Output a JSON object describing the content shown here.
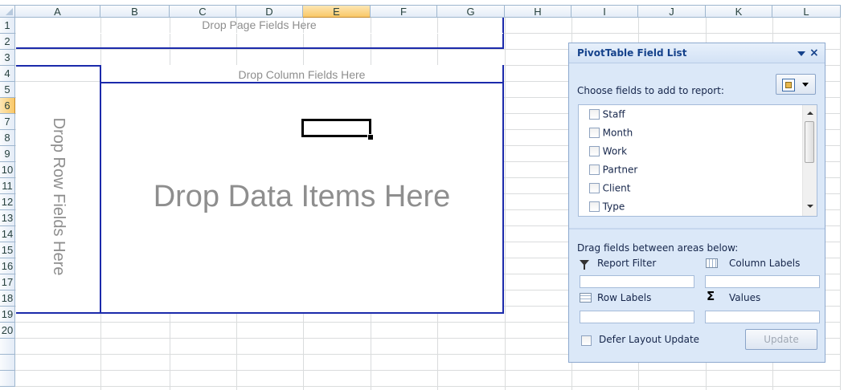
{
  "columns": [
    "A",
    "B",
    "C",
    "D",
    "E",
    "F",
    "G",
    "H",
    "I",
    "J",
    "K",
    "L"
  ],
  "rows": [
    "1",
    "2",
    "3",
    "4",
    "5",
    "6",
    "7",
    "8",
    "9",
    "10",
    "11",
    "12",
    "13",
    "14",
    "15",
    "16",
    "17",
    "18",
    "19",
    "20"
  ],
  "selected_column": "E",
  "selected_row": "6",
  "pivot": {
    "page_fields": "Drop Page Fields Here",
    "column_fields": "Drop Column Fields Here",
    "row_fields": "Drop Row Fields Here",
    "data_items": "Drop Data Items Here"
  },
  "pane": {
    "title": "PivotTable Field List",
    "choose_label": "Choose fields to add to report:",
    "fields": [
      "Staff",
      "Month",
      "Work",
      "Partner",
      "Client",
      "Type"
    ],
    "drag_label": "Drag fields between areas below:",
    "report_filter": "Report Filter",
    "column_labels": "Column Labels",
    "row_labels": "Row Labels",
    "values": "Values",
    "defer_label": "Defer Layout Update",
    "update_button": "Update"
  },
  "icons": {
    "menu": "dropdown-arrow-icon",
    "close": "close-icon",
    "layout": "field-list-layout-icon",
    "filter": "filter-funnel-icon",
    "column_labels": "column-grid-icon",
    "row_labels": "row-grid-icon",
    "values": "sigma-icon"
  },
  "colors": {
    "pivot_border": "#1b2aab",
    "placeholder_text": "#8e8e8e",
    "pane_background": "#dbe8f8",
    "selection_header": "#f9c867"
  }
}
